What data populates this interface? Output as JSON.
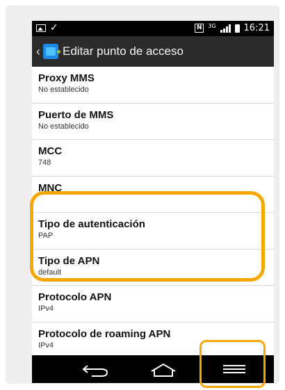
{
  "status_bar": {
    "time": "16:21",
    "network": "3G"
  },
  "action_bar": {
    "title": "Editar punto de acceso"
  },
  "items": [
    {
      "title": "Proxy MMS",
      "value": "No establecido"
    },
    {
      "title": "Puerto de MMS",
      "value": "No establecido"
    },
    {
      "title": "MCC",
      "value": "748"
    },
    {
      "title": "MNC",
      "value": ""
    },
    {
      "title": "Tipo de autenticación",
      "value": "PAP"
    },
    {
      "title": "Tipo de APN",
      "value": "default"
    },
    {
      "title": "Protocolo APN",
      "value": "IPv4"
    },
    {
      "title": "Protocolo de roaming APN",
      "value": "IPv4"
    }
  ],
  "colors": {
    "highlight": "#f4a800",
    "action_bar": "#2b2b2b",
    "status_bar": "#000000"
  }
}
